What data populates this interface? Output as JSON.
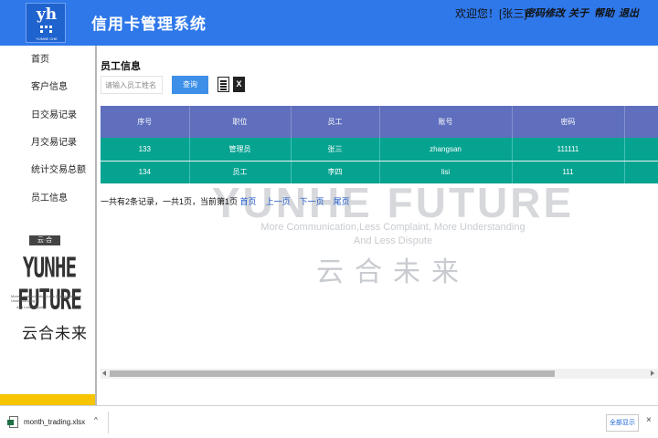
{
  "header": {
    "logo_text": "yh",
    "logo_small": "YUNHE CHE",
    "title": "信用卡管理系统",
    "welcome": "欢迎您！[张三]",
    "links": [
      "密码修改",
      "关于",
      "帮助",
      "退出"
    ]
  },
  "sidebar": {
    "items": [
      "首页",
      "客户信息",
      "日交易记录",
      "月交易记录",
      "统计交易总额",
      "员工信息"
    ],
    "logo_badge": "云·合",
    "logo_big": "YUNHE FUTURE",
    "logo_small_1": "More Communication,Less Complaint,More Understanding",
    "logo_small_2": "And Less Dispute",
    "logo_cn": "云合未来"
  },
  "main": {
    "section_title": "员工信息",
    "search_placeholder": "请输入员工姓名",
    "query_label": "查询",
    "excel_label": "X",
    "table": {
      "headers": [
        "序号",
        "职位",
        "员工",
        "账号",
        "密码",
        ""
      ],
      "rows": [
        [
          "133",
          "管理员",
          "张三",
          "zhangsan",
          "111111",
          ""
        ],
        [
          "134",
          "员工",
          "李四",
          "lisi",
          "111",
          ""
        ]
      ]
    },
    "pager": {
      "summary": "一共有2条记录，一共1页，当前第1页",
      "first": "首页",
      "prev": "上一页",
      "next": "下一页",
      "last": "尾页"
    }
  },
  "watermark": {
    "line1": "YUNHE FUTURE",
    "line2": "More Communication,Less Complaint, More Understanding",
    "line3": "And Less Dispute",
    "line4": "云合未来"
  },
  "download_bar": {
    "file_name": "month_trading.xlsx",
    "chevron": "^",
    "show_all": "全部显示",
    "close": "×"
  },
  "colors": {
    "header_bg": "#2f78ea",
    "table_header": "#5f6fbd",
    "table_row": "#07a391",
    "query_button": "#3d8fe8",
    "link": "#1b56c4",
    "sidebar_accent": "#f6c400"
  }
}
